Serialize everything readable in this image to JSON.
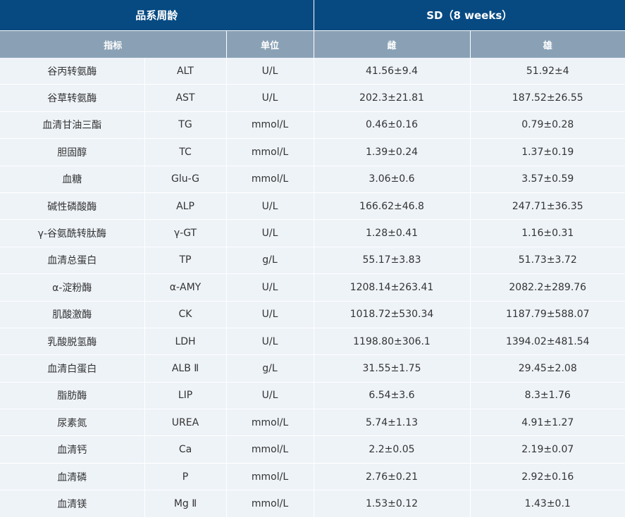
{
  "header": {
    "group_label": "品系周龄",
    "sd_label": "SD（8 weeks）",
    "col_indicator": "指标",
    "col_unit": "单位",
    "col_female": "雌",
    "col_male": "雄"
  },
  "rows": [
    {
      "name": "谷丙转氨酶",
      "abbr": "ALT",
      "unit": "U/L",
      "female": "41.56±9.4",
      "male": "51.92±4"
    },
    {
      "name": "谷草转氨酶",
      "abbr": "AST",
      "unit": "U/L",
      "female": "202.3±21.81",
      "male": "187.52±26.55"
    },
    {
      "name": "血清甘油三酯",
      "abbr": "TG",
      "unit": "mmol/L",
      "female": "0.46±0.16",
      "male": "0.79±0.28"
    },
    {
      "name": "胆固醇",
      "abbr": "TC",
      "unit": "mmol/L",
      "female": "1.39±0.24",
      "male": "1.37±0.19"
    },
    {
      "name": "血糖",
      "abbr": "Glu-G",
      "unit": "mmol/L",
      "female": "3.06±0.6",
      "male": "3.57±0.59"
    },
    {
      "name": "碱性磷酸酶",
      "abbr": "ALP",
      "unit": "U/L",
      "female": "166.62±46.8",
      "male": "247.71±36.35"
    },
    {
      "name": "γ-谷氨酰转肽酶",
      "abbr": "γ-GT",
      "unit": "U/L",
      "female": "1.28±0.41",
      "male": "1.16±0.31"
    },
    {
      "name": "血清总蛋白",
      "abbr": "TP",
      "unit": "g/L",
      "female": "55.17±3.83",
      "male": "51.73±3.72"
    },
    {
      "name": "α-淀粉酶",
      "abbr": "α-AMY",
      "unit": "U/L",
      "female": "1208.14±263.41",
      "male": "2082.2±289.76"
    },
    {
      "name": "肌酸激酶",
      "abbr": "CK",
      "unit": "U/L",
      "female": "1018.72±530.34",
      "male": "1187.79±588.07"
    },
    {
      "name": "乳酸脱氢酶",
      "abbr": "LDH",
      "unit": "U/L",
      "female": "1198.80±306.1",
      "male": "1394.02±481.54"
    },
    {
      "name": "血清白蛋白",
      "abbr": "ALB Ⅱ",
      "unit": "g/L",
      "female": "31.55±1.75",
      "male": "29.45±2.08"
    },
    {
      "name": "脂肪酶",
      "abbr": "LIP",
      "unit": "U/L",
      "female": "6.54±3.6",
      "male": "8.3±1.76"
    },
    {
      "name": "尿素氮",
      "abbr": "UREA",
      "unit": "mmol/L",
      "female": "5.74±1.13",
      "male": "4.91±1.27"
    },
    {
      "name": "血清钙",
      "abbr": "Ca",
      "unit": "mmol/L",
      "female": "2.2±0.05",
      "male": "2.19±0.07"
    },
    {
      "name": "血清磷",
      "abbr": "P",
      "unit": "mmol/L",
      "female": "2.76±0.21",
      "male": "2.92±0.16"
    },
    {
      "name": "血清镁",
      "abbr": "Mg Ⅱ",
      "unit": "mmol/L",
      "female": "1.53±0.12",
      "male": "1.43±0.1"
    }
  ],
  "colors": {
    "header_dark": "#074a82",
    "header_light": "#8aa1b5",
    "row_bg": "#eef3f8",
    "text": "#333333"
  }
}
